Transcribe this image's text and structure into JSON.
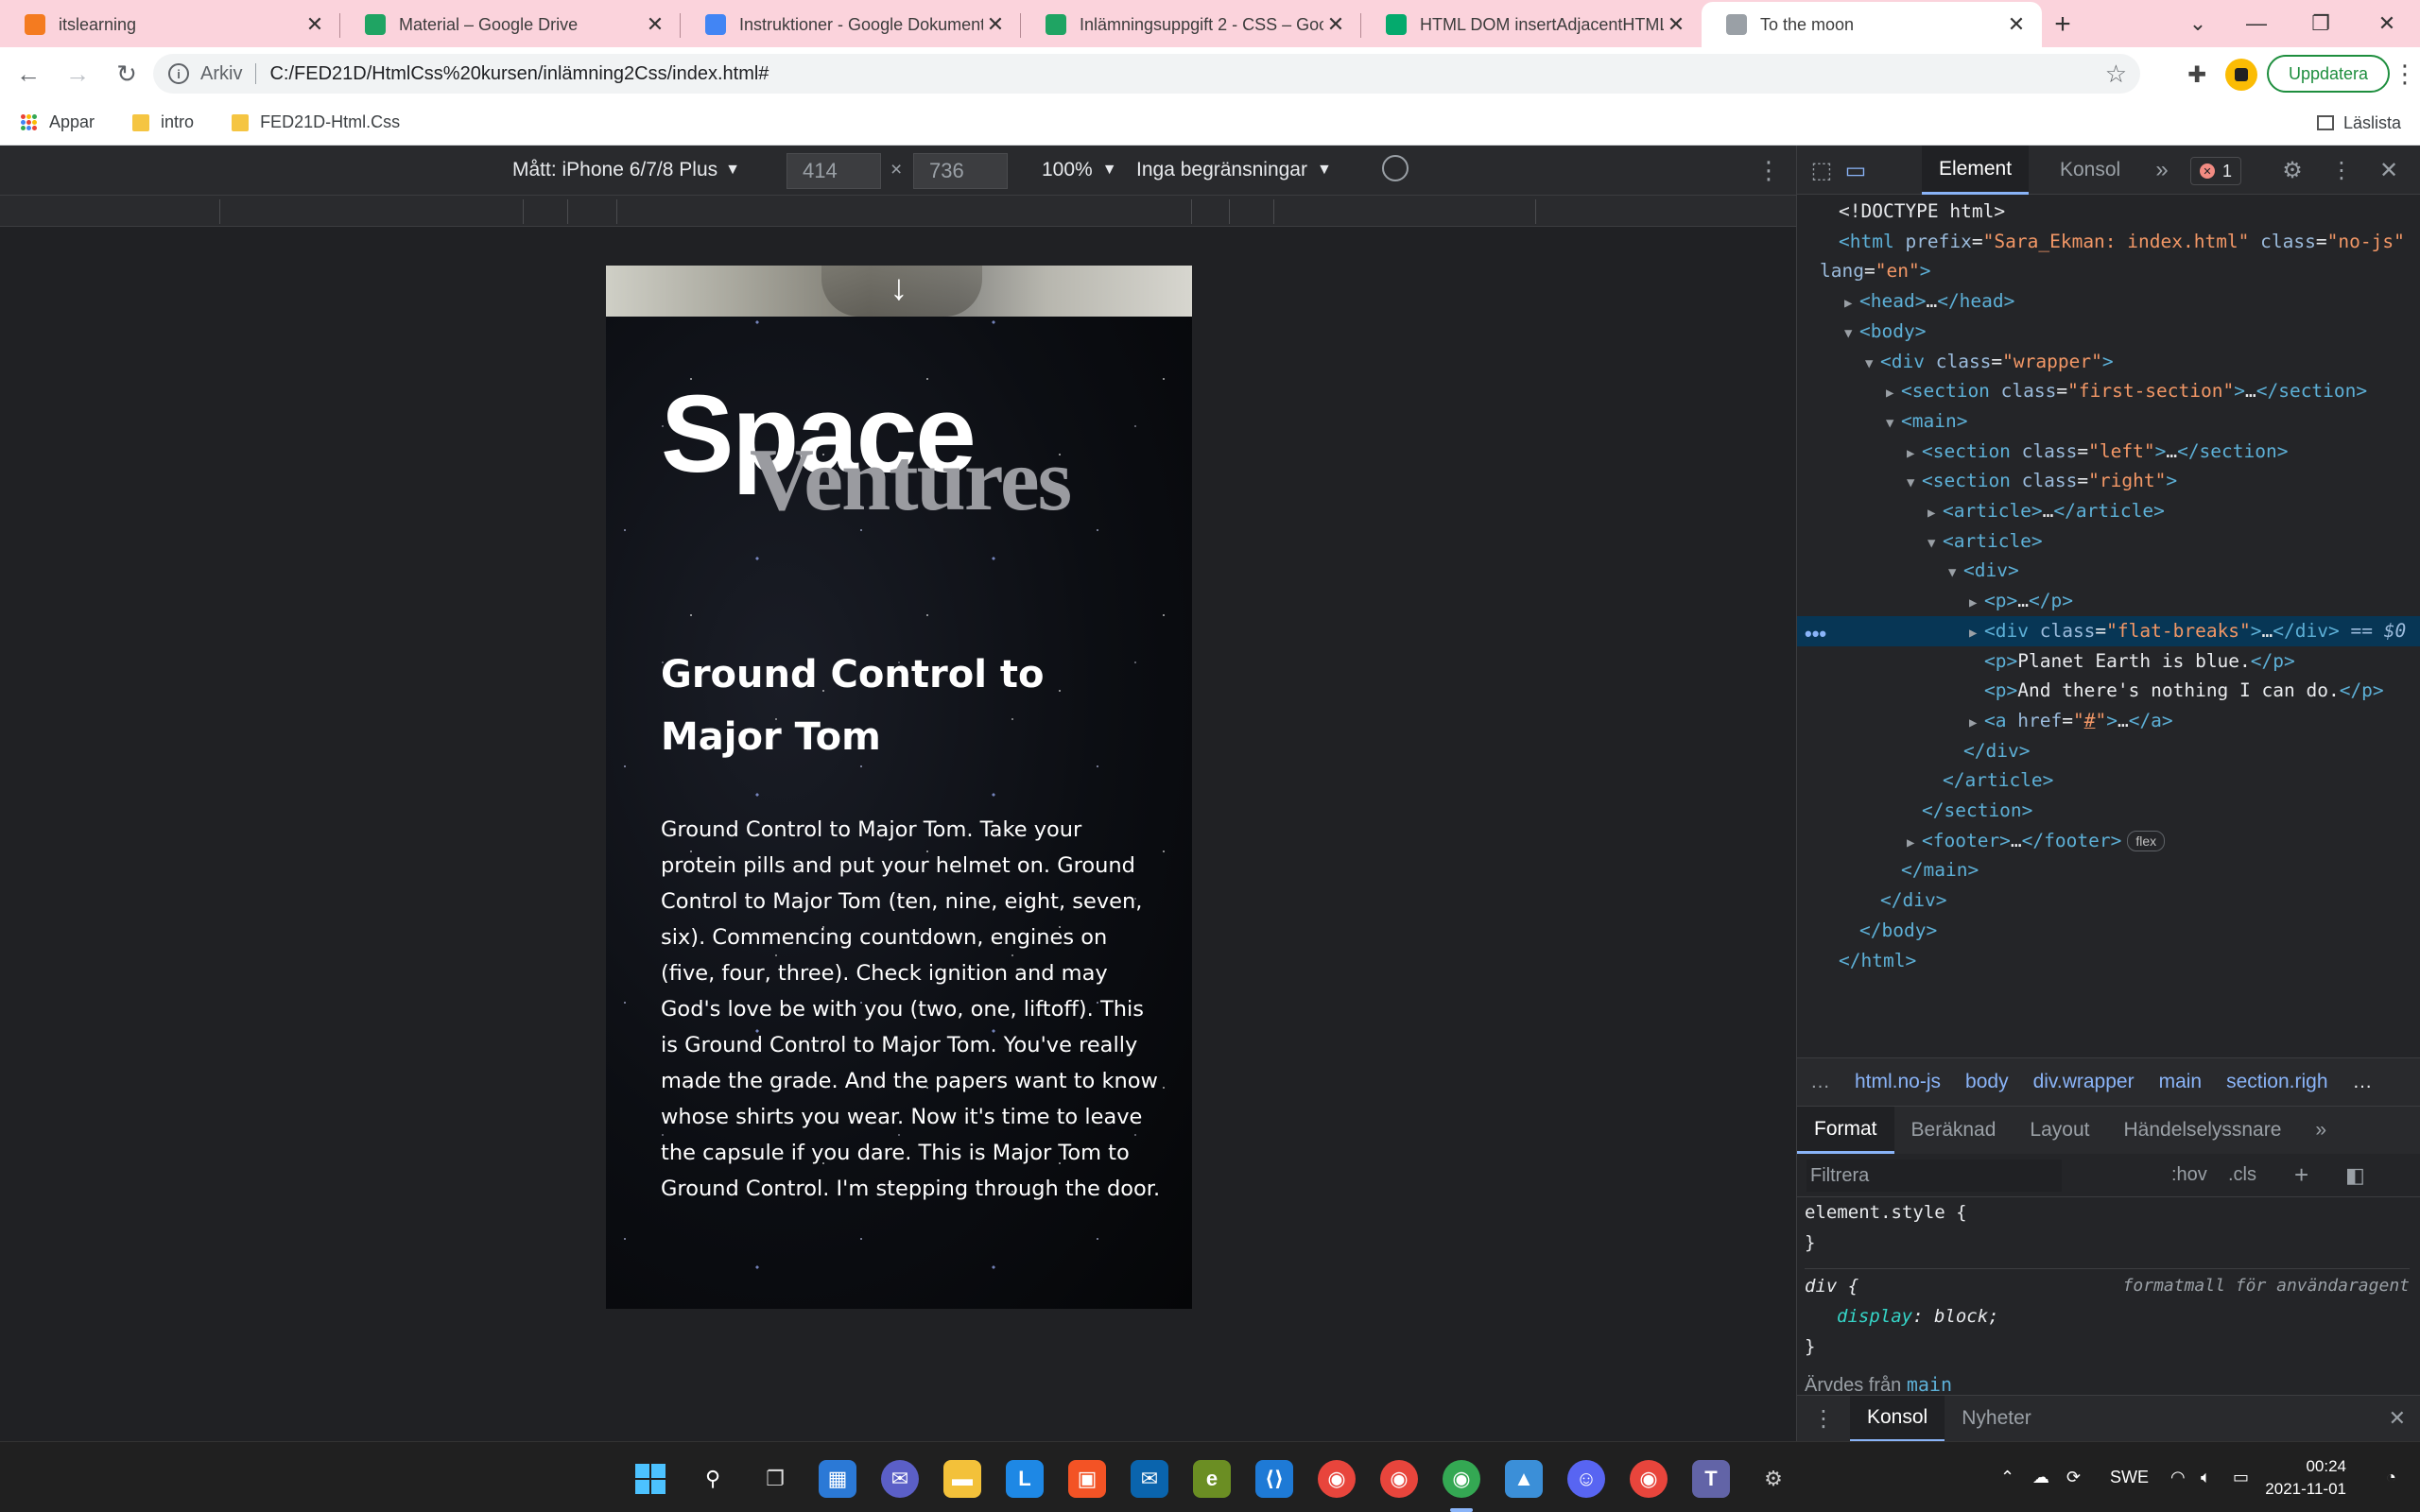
{
  "browser": {
    "tabs": [
      {
        "title": "itslearning",
        "favicon": "its-logo-icon",
        "color": "#f47b20"
      },
      {
        "title": "Material – Google Drive",
        "favicon": "google-drive-icon",
        "color": "#1fa463"
      },
      {
        "title": "Instruktioner - Google Dokument",
        "favicon": "google-docs-icon",
        "color": "#4285f4"
      },
      {
        "title": "Inlämningsuppgift 2 - CSS – Goo",
        "favicon": "google-drive-icon",
        "color": "#1fa463"
      },
      {
        "title": "HTML DOM insertAdjacentHTML",
        "favicon": "w3schools-icon",
        "color": "#04aa6d"
      },
      {
        "title": "To the moon",
        "favicon": "moon-icon",
        "color": "#9aa0a6"
      }
    ],
    "active_tab_index": 5,
    "address": {
      "scheme_label": "Arkiv",
      "url": "C:/FED21D/HtmlCss%20kursen/inlämning2Css/index.html#"
    },
    "update_label": "Uppdatera",
    "bookmarks": [
      {
        "label": "Appar",
        "icon": "apps-grid-icon"
      },
      {
        "label": "intro",
        "icon": "folder-icon"
      },
      {
        "label": "FED21D-Html.Css",
        "icon": "folder-icon"
      }
    ],
    "reading_list_label": "Läslista"
  },
  "device_toolbar": {
    "device_label": "Mått: iPhone 6/7/8 Plus",
    "width": "414",
    "height": "736",
    "times": "×",
    "zoom": "100%",
    "throttle": "Inga begränsningar"
  },
  "page": {
    "brand_top": "Space",
    "brand_bottom": "Ventures",
    "heading": "Ground Control to Major Tom",
    "body": "Ground Control to Major Tom. Take your protein pills and put your helmet on. Ground Control to Major Tom (ten, nine, eight, seven, six). Commencing countdown, engines on (five, four, three). Check ignition and may God's love be with you (two, one, liftoff). This is Ground Control to Major Tom. You've really made the grade. And the papers want to know whose shirts you wear. Now it's time to leave the capsule if you dare. This is Major Tom to Ground Control. I'm stepping through the door."
  },
  "devtools": {
    "tabs": [
      "Element",
      "Konsol"
    ],
    "error_count": "1",
    "dom_lines": [
      {
        "indent": 0,
        "tri": "",
        "html": "<span class='txt'>&lt;!DOCTYPE html&gt;</span>"
      },
      {
        "indent": 0,
        "tri": "",
        "html": "<span class='tag'>&lt;html</span> <span class='attr'>prefix</span>=<span class='val'>\"Sara_Ekman: index.html\"</span> <span class='attr'>class</span>=<span class='val'>\"no-js\"</span>"
      },
      {
        "indent": -1,
        "tri": "",
        "html": "<span class='attr'>lang</span>=<span class='val'>\"en\"</span><span class='tag'>&gt;</span>"
      },
      {
        "indent": 1,
        "tri": "▶",
        "html": "<span class='tag'>&lt;head&gt;</span>…<span class='tag'>&lt;/head&gt;</span>"
      },
      {
        "indent": 1,
        "tri": "▼",
        "html": "<span class='tag'>&lt;body&gt;</span>"
      },
      {
        "indent": 2,
        "tri": "▼",
        "html": "<span class='tag'>&lt;div</span> <span class='attr'>class</span>=<span class='val'>\"wrapper\"</span><span class='tag'>&gt;</span>"
      },
      {
        "indent": 3,
        "tri": "▶",
        "html": "<span class='tag'>&lt;section</span> <span class='attr'>class</span>=<span class='val'>\"first-section\"</span><span class='tag'>&gt;</span>…<span class='tag'>&lt;/section&gt;</span>"
      },
      {
        "indent": 3,
        "tri": "▼",
        "html": "<span class='tag'>&lt;main&gt;</span>"
      },
      {
        "indent": 4,
        "tri": "▶",
        "html": "<span class='tag'>&lt;section</span> <span class='attr'>class</span>=<span class='val'>\"left\"</span><span class='tag'>&gt;</span>…<span class='tag'>&lt;/section&gt;</span>"
      },
      {
        "indent": 4,
        "tri": "▼",
        "html": "<span class='tag'>&lt;section</span> <span class='attr'>class</span>=<span class='val'>\"right\"</span><span class='tag'>&gt;</span>"
      },
      {
        "indent": 5,
        "tri": "▶",
        "html": "<span class='tag'>&lt;article&gt;</span>…<span class='tag'>&lt;/article&gt;</span>"
      },
      {
        "indent": 5,
        "tri": "▼",
        "html": "<span class='tag'>&lt;article&gt;</span>"
      },
      {
        "indent": 6,
        "tri": "▼",
        "html": "<span class='tag'>&lt;div&gt;</span>"
      },
      {
        "indent": 7,
        "tri": "▶",
        "html": "<span class='tag'>&lt;p&gt;</span>…<span class='tag'>&lt;/p&gt;</span>"
      },
      {
        "indent": 7,
        "tri": "▶",
        "html": "<span class='tag'>&lt;div</span> <span class='attr'>class</span>=<span class='val'>\"flat-breaks\"</span><span class='tag'>&gt;</span>…<span class='tag'>&lt;/div&gt;</span> <span class='attr' style='font-style:italic'>== $0</span>",
        "selected": true
      },
      {
        "indent": 7,
        "tri": "",
        "html": "<span class='tag'>&lt;p&gt;</span><span class='txt'>Planet Earth is blue.</span><span class='tag'>&lt;/p&gt;</span>"
      },
      {
        "indent": 7,
        "tri": "",
        "html": "<span class='tag'>&lt;p&gt;</span><span class='txt'>And there's nothing I can do.</span><span class='tag'>&lt;/p&gt;</span>"
      },
      {
        "indent": 7,
        "tri": "▶",
        "html": "<span class='tag'>&lt;a</span> <span class='attr'>href</span>=<span class='val'>\"<u>#</u>\"</span><span class='tag'>&gt;</span>…<span class='tag'>&lt;/a&gt;</span>"
      },
      {
        "indent": 6,
        "tri": "",
        "html": "<span class='tag'>&lt;/div&gt;</span>"
      },
      {
        "indent": 5,
        "tri": "",
        "html": "<span class='tag'>&lt;/article&gt;</span>"
      },
      {
        "indent": 4,
        "tri": "",
        "html": "<span class='tag'>&lt;/section&gt;</span>"
      },
      {
        "indent": 4,
        "tri": "▶",
        "html": "<span class='tag'>&lt;footer&gt;</span>…<span class='tag'>&lt;/footer&gt;</span><span class='flexbadge'>flex</span>"
      },
      {
        "indent": 3,
        "tri": "",
        "html": "<span class='tag'>&lt;/main&gt;</span>"
      },
      {
        "indent": 2,
        "tri": "",
        "html": "<span class='tag'>&lt;/div&gt;</span>"
      },
      {
        "indent": 1,
        "tri": "",
        "html": "<span class='tag'>&lt;/body&gt;</span>"
      },
      {
        "indent": 0,
        "tri": "",
        "html": "<span class='tag'>&lt;/html&gt;</span>"
      }
    ],
    "breadcrumbs": [
      "…",
      "html.no-js",
      "body",
      "div.wrapper",
      "main",
      "section.righ",
      "…"
    ],
    "styles_tabs": [
      "Format",
      "Beräknad",
      "Layout",
      "Händelselyssnare"
    ],
    "filter_placeholder": "Filtrera",
    "hov_label": ":hov",
    "cls_label": ".cls",
    "rules": {
      "element_style": "element.style {",
      "close": "}",
      "div_selector": "div {",
      "ua_label": "formatmall för användaragent",
      "prop_name": "display",
      "prop_value": "block;",
      "inherited_label": "Ärvdes från",
      "inherited_from": "main"
    },
    "drawer_tabs": [
      "Konsol",
      "Nyheter"
    ]
  },
  "taskbar": {
    "language": "SWE",
    "time": "00:24",
    "date": "2021-11-01"
  }
}
